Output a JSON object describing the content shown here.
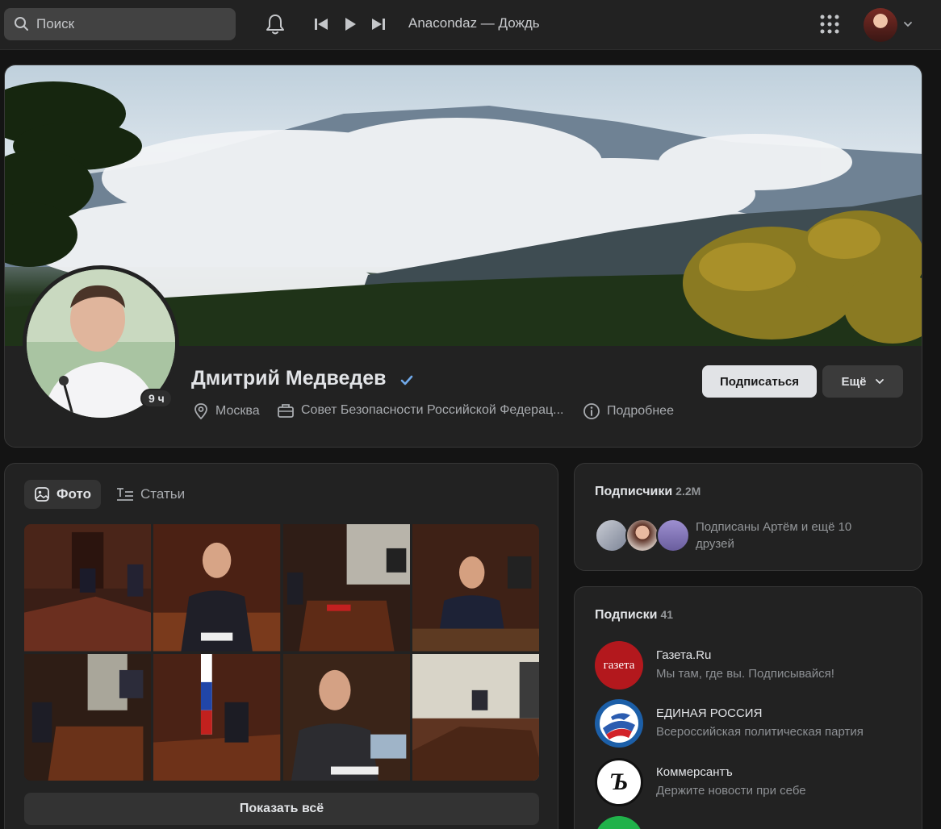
{
  "topbar": {
    "search_placeholder": "Поиск",
    "now_playing": "Anacondaz — Дождь",
    "icons": [
      "search-icon",
      "bell-icon",
      "previous-icon",
      "play-icon",
      "next-icon",
      "apps-grid-icon",
      "chevron-down-icon"
    ]
  },
  "profile": {
    "name": "Дмитрий Медведев",
    "online_badge": "9 ч",
    "city": "Москва",
    "work": "Совет Безопасности Российской Федерац...",
    "details": "Подробнее",
    "subscribe_label": "Подписаться",
    "more_label": "Ещё"
  },
  "media": {
    "tabs": [
      {
        "label": "Фото",
        "active": true
      },
      {
        "label": "Статьи",
        "active": false
      }
    ],
    "show_all_label": "Показать всё"
  },
  "followers": {
    "title": "Подписчики",
    "count": "2.2M",
    "friends_text": "Подписаны Артём и ещё 10 друзей"
  },
  "subscriptions": {
    "title": "Подписки",
    "count": "41",
    "items": [
      {
        "name": "Газета.Ru",
        "desc": "Мы там, где вы. Подписывайся!",
        "logo_text": "газета",
        "color": "#b3181d"
      },
      {
        "name": "ЕДИНАЯ РОССИЯ",
        "desc": "Всероссийская политическая партия",
        "logo_text": "",
        "color": "#1c5fa8"
      },
      {
        "name": "Коммерсантъ",
        "desc": "Держите новости при себе",
        "logo_text": "Ъ",
        "color": "#ffffff"
      }
    ]
  },
  "colors": {
    "background": "#141414",
    "card": "#222222",
    "accent_verified": "#71aaeb",
    "button_primary": "#e1e3e6"
  }
}
